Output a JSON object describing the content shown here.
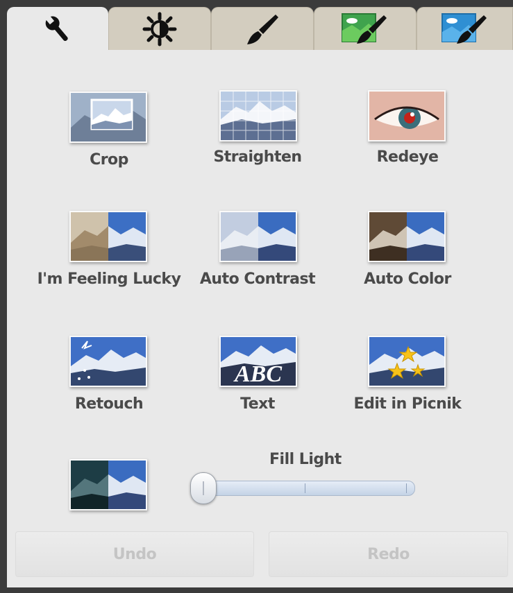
{
  "tabs": [
    {
      "icon": "wrench-icon",
      "active": true
    },
    {
      "icon": "exposure-icon",
      "active": false
    },
    {
      "icon": "brush-icon",
      "active": false
    },
    {
      "icon": "green-landscape-brush-icon",
      "active": false
    },
    {
      "icon": "blue-landscape-brush-icon",
      "active": false
    }
  ],
  "tools": [
    {
      "label": "Crop"
    },
    {
      "label": "Straighten"
    },
    {
      "label": "Redeye"
    },
    {
      "label": "I'm Feeling Lucky"
    },
    {
      "label": "Auto Contrast"
    },
    {
      "label": "Auto Color"
    },
    {
      "label": "Retouch"
    },
    {
      "label": "Text"
    },
    {
      "label": "Edit in Picnik"
    }
  ],
  "text_tile_caption": "ABC",
  "fill_light": {
    "label": "Fill Light",
    "value": 0.0
  },
  "undo_label": "Undo",
  "redo_label": "Redo",
  "colors": {
    "tab_inactive": "#d3cdbf",
    "panel": "#e9e9e9",
    "frame": "#3b3b3b"
  }
}
